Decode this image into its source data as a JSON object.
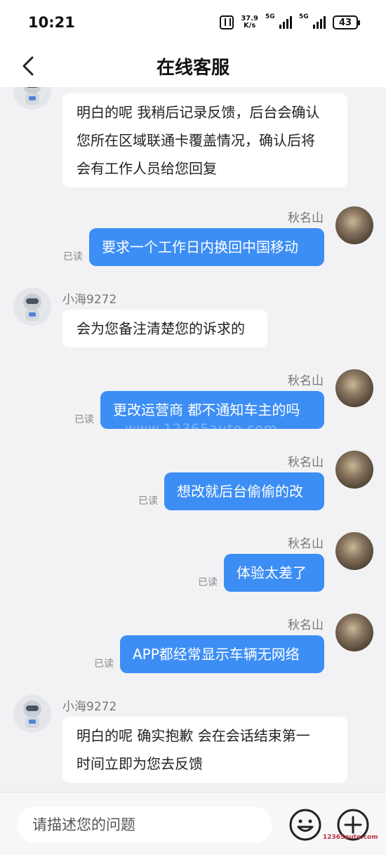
{
  "status_bar": {
    "time": "10:21",
    "net_speed_value": "37.9",
    "net_speed_unit": "K/s",
    "signal1_label": "5G",
    "signal2_label": "5G",
    "battery": "43"
  },
  "header": {
    "title": "在线客服"
  },
  "messages": [
    {
      "id": 0,
      "direction": "incoming",
      "sender": "",
      "lines": [
        "明白的呢 我稍后记录反馈，后台会确认",
        "您所在区域联通卡覆盖情况，确认后将",
        "会有工作人员给您回复"
      ],
      "read": ""
    },
    {
      "id": 1,
      "direction": "outgoing",
      "sender": "秋名山",
      "lines": [
        "要求一个工作日内换回中国移动"
      ],
      "read": "已读"
    },
    {
      "id": 2,
      "direction": "incoming",
      "sender": "小海9272",
      "lines": [
        "会为您备注清楚您的诉求的"
      ],
      "read": ""
    },
    {
      "id": 3,
      "direction": "outgoing",
      "sender": "秋名山",
      "lines": [
        "更改运营商 都不通知车主的吗"
      ],
      "read": "已读"
    },
    {
      "id": 4,
      "direction": "outgoing",
      "sender": "秋名山",
      "lines": [
        "想改就后台偷偷的改"
      ],
      "read": "已读"
    },
    {
      "id": 5,
      "direction": "outgoing",
      "sender": "秋名山",
      "lines": [
        "体验太差了"
      ],
      "read": "已读"
    },
    {
      "id": 6,
      "direction": "outgoing",
      "sender": "秋名山",
      "lines": [
        "APP都经常显示车辆无网络"
      ],
      "read": "已读"
    },
    {
      "id": 7,
      "direction": "incoming",
      "sender": "小海9272",
      "lines": [
        "明白的呢 确实抱歉 会在会话结束第一",
        "时间立即为您去反馈"
      ],
      "read": ""
    }
  ],
  "watermark": "www.12365auto.com",
  "input": {
    "placeholder": "请描述您的问题"
  },
  "icons": {
    "back": "chevron-left-icon",
    "emoji": "smile-icon",
    "plus": "plus-circle-icon"
  },
  "colors": {
    "outgoing_bubble": "#3d8ef4",
    "incoming_bubble": "#ffffff",
    "background": "#f2f2f4"
  },
  "logo_text": "12365auto.com"
}
